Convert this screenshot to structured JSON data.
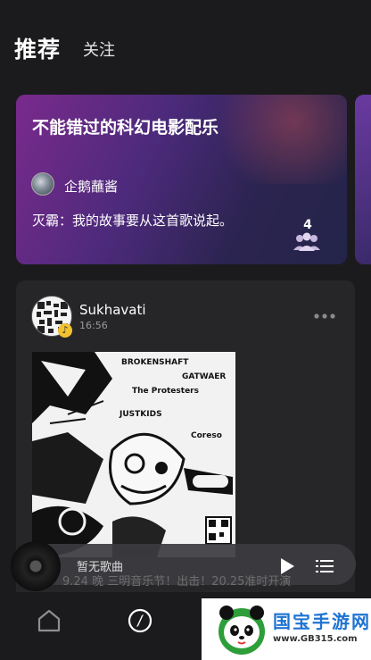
{
  "header": {
    "tabs": [
      {
        "label": "推荐",
        "active": true
      },
      {
        "label": "关注",
        "active": false
      }
    ]
  },
  "feature_card": {
    "title": "不能错过的科幻电影配乐",
    "author": "企鹅蘸酱",
    "quote": "灭霸：我的故事要从这首歌说起。",
    "member_count": "4",
    "icon": "people-icon"
  },
  "post": {
    "author": "Sukhavati",
    "time": "16:56",
    "more_icon": "more-dots-icon",
    "badge_icon": "music-note-icon",
    "poster_text": {
      "line1": "BROKENSHAFT",
      "line2": "GATWAER",
      "line3": "The Protesters",
      "line4": "JUSTKIDS",
      "line5": "Coreso"
    }
  },
  "player": {
    "status": "暂无歌曲",
    "scroll_text": "9.24 晚 三明音乐节！出击！20.25准时开演",
    "play_icon": "play-icon",
    "list_icon": "playlist-icon"
  },
  "bottom_nav": {
    "items": [
      {
        "icon": "home-icon"
      },
      {
        "icon": "compass-icon"
      }
    ]
  },
  "watermark": {
    "title": "国宝手游网",
    "url": "www.GB315.com"
  },
  "colors": {
    "background": "#1b1b1d",
    "card": "#262628",
    "watermark_blue": "#1e73d2",
    "badge_yellow": "#f2c230"
  }
}
